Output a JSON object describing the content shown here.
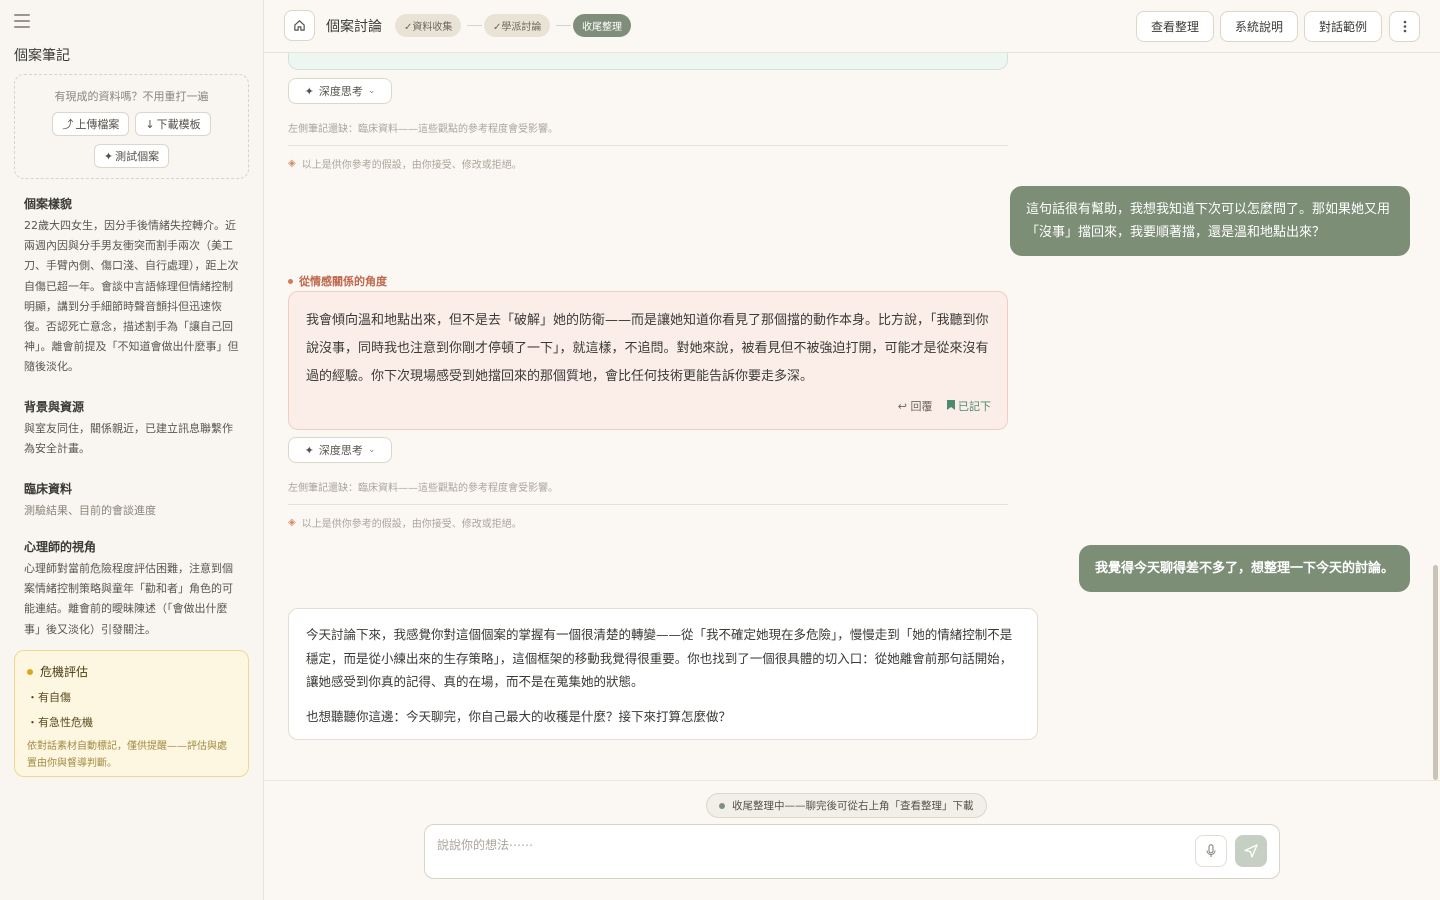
{
  "sidebar": {
    "title": "個案筆記",
    "upload_hint": "有現成的資料嗎？不用重打一遍",
    "upload_label": "上傳檔案",
    "download_label": "下載模板",
    "test_label": "測試個案",
    "sections": [
      {
        "heading": "個案樣貌",
        "body": "22歲大四女生，因分手後情緒失控轉介。近兩週內因與分手男友衝突而割手兩次（美工刀、手臂內側、傷口淺、自行處理），距上次自傷已超一年。會談中言語條理但情緒控制明顯，講到分手細節時聲音顫抖但迅速恢復。否認死亡意念，描述割手為「讓自己回神」。離會前提及「不知道會做出什麼事」但隨後淡化。"
      },
      {
        "heading": "背景與資源",
        "body": "與室友同住，關係親近，已建立訊息聯繫作為安全計畫。"
      },
      {
        "heading": "臨床資料",
        "body": "測驗結果、目前的會談進度"
      },
      {
        "heading": "心理師的視角",
        "body": "心理師對當前危險程度評估困難，注意到個案情緒控制策略與童年「勸和者」角色的可能連結。離會前的曖昧陳述（「會做出什麼事」後又淡化）引發關注。"
      }
    ],
    "risk": {
      "heading": "危機評估",
      "items": [
        "・有自傷",
        "・有急性危機"
      ],
      "note": "依對話素材自動標記，僅供提醒——評估與處置由你與督導判斷。"
    }
  },
  "header": {
    "title": "個案討論",
    "steps": [
      "✓資料收集",
      "✓學派討論",
      "收尾整理"
    ],
    "buttons": [
      "查看整理",
      "系統說明",
      "對話範例"
    ]
  },
  "chat": {
    "deep_label": "深度思考",
    "missing_note": "左側筆記還缺：臨床資料——這些觀點的參考程度會受影響。",
    "assumption_note": "以上是供你參考的假設，由你接受、修改或拒絕。",
    "user_msg_1": "這句話很有幫助，我想我知道下次可以怎麼問了。那如果她又用「沒事」擋回來，我要順著擋，還是溫和地點出來？",
    "perspective_label": "從情感關係的角度",
    "perspective_text": "我會傾向溫和地點出來，但不是去「破解」她的防衛——而是讓她知道你看見了那個擋的動作本身。比方說，「我聽到你說沒事，同時我也注意到你剛才停頓了一下」，就這樣，不追問。對她來說，被看見但不被強迫打開，可能才是從來沒有過的經驗。你下次現場感受到她擋回來的那個質地，會比任何技術更能告訴你要走多深。",
    "reply_label": "回覆",
    "saved_label": "已記下",
    "user_msg_2": "我覺得今天聊得差不多了，想整理一下今天的討論。",
    "summary_p1": "今天討論下來，我感覺你對這個個案的掌握有一個很清楚的轉變——從「我不確定她現在多危險」，慢慢走到「她的情緒控制不是穩定，而是從小練出來的生存策略」，這個框架的移動我覺得很重要。你也找到了一個很具體的切入口：從她離會前那句話開始，讓她感受到你真的記得、真的在場，而不是在蒐集她的狀態。",
    "summary_p2": "也想聽聽你這邊：今天聊完，你自己最大的收穫是什麼？接下來打算怎麼做？"
  },
  "footer": {
    "status": "收尾整理中——聊完後可從右上角「查看整理」下載",
    "placeholder": "說說你的想法⋯⋯"
  },
  "colors": {
    "accent": "#7d8e77",
    "warm_card": "#fbeee9",
    "risk_bg": "#fdf7e2"
  }
}
